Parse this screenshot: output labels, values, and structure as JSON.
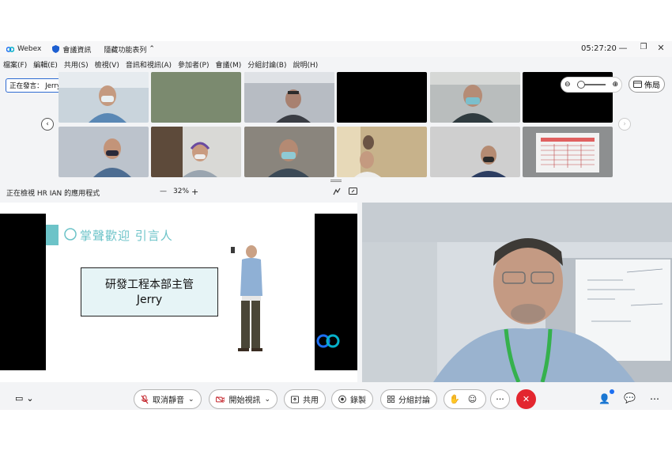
{
  "titlebar": {
    "app_name": "Webex",
    "meeting_info": "會議資訊",
    "hide_toolbar": "隱藏功能表列",
    "time": "05:27:20"
  },
  "menu": [
    "檔案(F)",
    "編輯(E)",
    "共用(S)",
    "檢視(V)",
    "音訊和視訊(A)",
    "參加者(P)",
    "會議(M)",
    "分組討論(B)",
    "說明(H)"
  ],
  "speaker": {
    "label": "正在發言： Jerry Pan"
  },
  "layout_button": "佈局",
  "view_bar": {
    "viewing": "正在檢視 HR IAN 的應用程式",
    "zoom_minus": "—",
    "zoom": "32%",
    "zoom_plus": "+"
  },
  "slide": {
    "title": "掌聲歡迎 引言人",
    "box_line1": "研發工程本部主管",
    "box_line2": "Jerry"
  },
  "controls": {
    "unmute": "取消靜音",
    "start_video": "開始視訊",
    "share": "共用",
    "record": "錄製",
    "breakout": "分組討論"
  },
  "colors": {
    "accent": "#2f6bd1",
    "end_call": "#e3262f",
    "slide_teal": "#6cc3c8",
    "slide_box": "#e6f4f6"
  }
}
